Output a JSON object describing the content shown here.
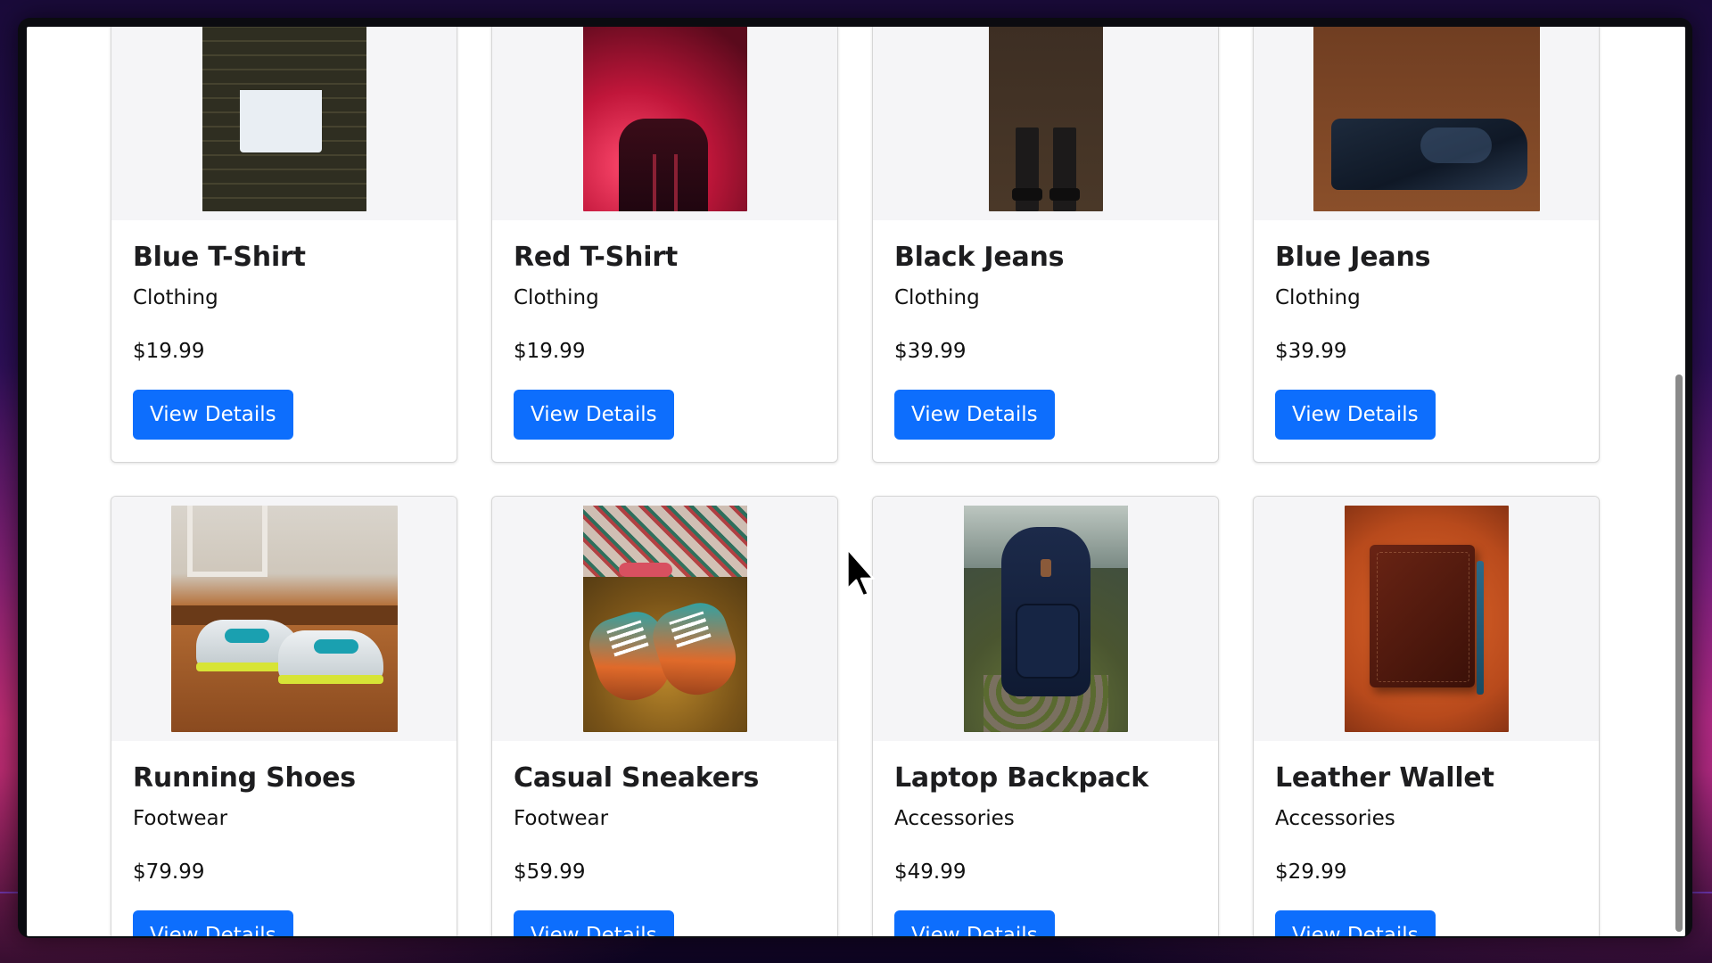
{
  "products": [
    {
      "name": "Blue T-Shirt",
      "category": "Clothing",
      "price": "$19.99",
      "button": "View Details",
      "image": "blue-tshirt-image"
    },
    {
      "name": "Red T-Shirt",
      "category": "Clothing",
      "price": "$19.99",
      "button": "View Details",
      "image": "red-tshirt-image"
    },
    {
      "name": "Black Jeans",
      "category": "Clothing",
      "price": "$39.99",
      "button": "View Details",
      "image": "black-jeans-image"
    },
    {
      "name": "Blue Jeans",
      "category": "Clothing",
      "price": "$39.99",
      "button": "View Details",
      "image": "blue-jeans-image"
    },
    {
      "name": "Running Shoes",
      "category": "Footwear",
      "price": "$79.99",
      "button": "View Details",
      "image": "running-shoes-image"
    },
    {
      "name": "Casual Sneakers",
      "category": "Footwear",
      "price": "$59.99",
      "button": "View Details",
      "image": "casual-sneakers-image"
    },
    {
      "name": "Laptop Backpack",
      "category": "Accessories",
      "price": "$49.99",
      "button": "View Details",
      "image": "laptop-backpack-image"
    },
    {
      "name": "Leather Wallet",
      "category": "Accessories",
      "price": "$29.99",
      "button": "View Details",
      "image": "leather-wallet-image"
    }
  ],
  "colors": {
    "button": "#0d6efd",
    "card_border": "#d6d6d6",
    "media_bg": "#f5f5f7"
  },
  "cursor": "arrow-cursor-icon"
}
